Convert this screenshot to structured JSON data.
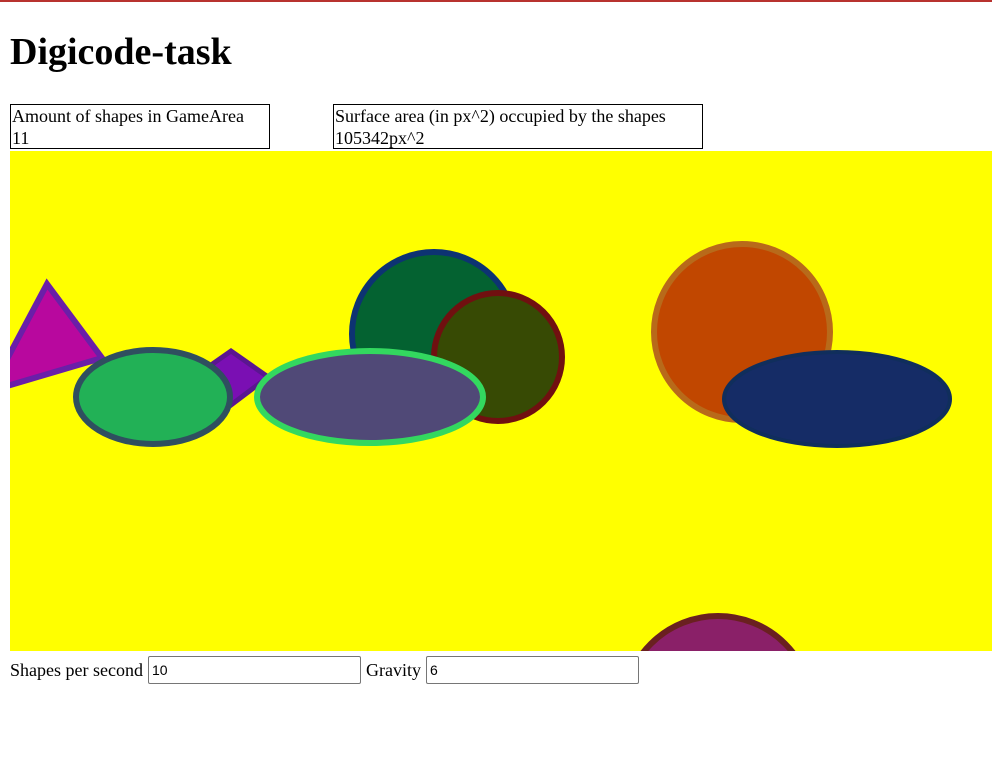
{
  "page": {
    "title": "Digicode-task"
  },
  "stats": {
    "count_label": "Amount of shapes in GameArea",
    "count_value": "11",
    "area_label": "Surface area (in px^2) occupied by the shapes",
    "area_value": "105342px^2"
  },
  "controls": {
    "shapes_label": "Shapes per second",
    "shapes_value": "10",
    "gravity_label": "Gravity",
    "gravity_value": "6"
  },
  "colors": {
    "accent_bar": "#b8322f",
    "game_background": "#ffff00"
  }
}
